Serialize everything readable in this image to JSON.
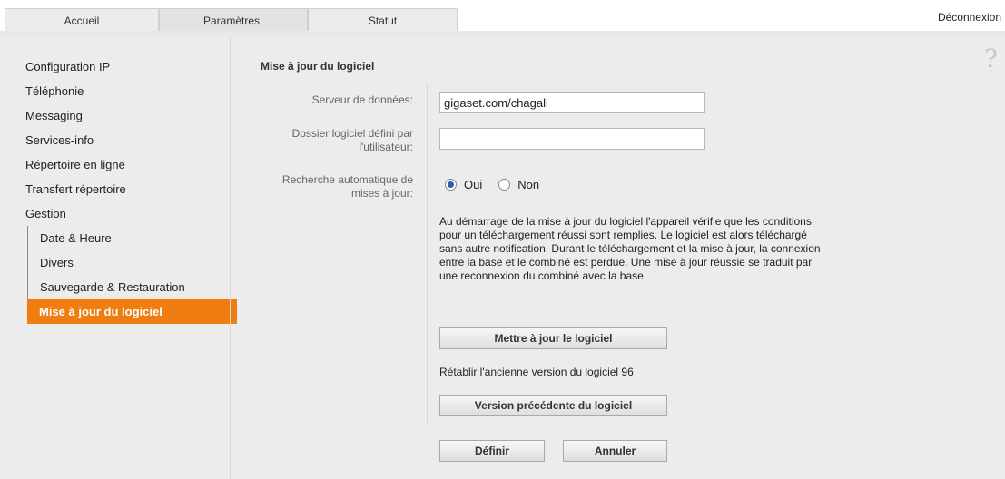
{
  "tabs": [
    {
      "label": "Accueil"
    },
    {
      "label": "Paramètres"
    },
    {
      "label": "Statut"
    }
  ],
  "logout_label": "Déconnexion",
  "help_symbol": "?",
  "sidebar": {
    "items": [
      {
        "label": "Configuration IP"
      },
      {
        "label": "Téléphonie"
      },
      {
        "label": "Messaging"
      },
      {
        "label": "Services-info"
      },
      {
        "label": "Répertoire en ligne"
      },
      {
        "label": "Transfert répertoire"
      },
      {
        "label": "Gestion"
      }
    ],
    "subitems": [
      {
        "label": "Date & Heure"
      },
      {
        "label": "Divers"
      },
      {
        "label": "Sauvegarde & Restauration"
      },
      {
        "label": "Mise à jour du logiciel"
      }
    ]
  },
  "form": {
    "title": "Mise à jour du logiciel",
    "server_label": "Serveur de données:",
    "server_value": "gigaset.com/chagall",
    "folder_label_line1": "Dossier logiciel défini par",
    "folder_label_line2": "l'utilisateur:",
    "folder_value": "",
    "auto_label_line1": "Recherche automatique de",
    "auto_label_line2": "mises à jour:",
    "radio_yes": "Oui",
    "radio_no": "Non",
    "auto_selected": "Oui",
    "info_text": "Au démarrage de la mise à jour du logiciel l'appareil vérifie que les conditions pour un téléchargement réussi sont remplies. Le logiciel est alors téléchargé sans autre notification. Durant le téléchargement et la mise à jour, la connexion entre la base et le combiné est perdue. Une mise à jour réussie se traduit par une reconnexion du combiné avec la base.",
    "update_button": "Mettre à jour le logiciel",
    "restore_text": "Rétablir l'ancienne version du logiciel 96",
    "previous_button": "Version précédente du logiciel",
    "define_button": "Définir",
    "cancel_button": "Annuler"
  },
  "colors": {
    "accent": "#f07d10",
    "background": "#ececec"
  }
}
